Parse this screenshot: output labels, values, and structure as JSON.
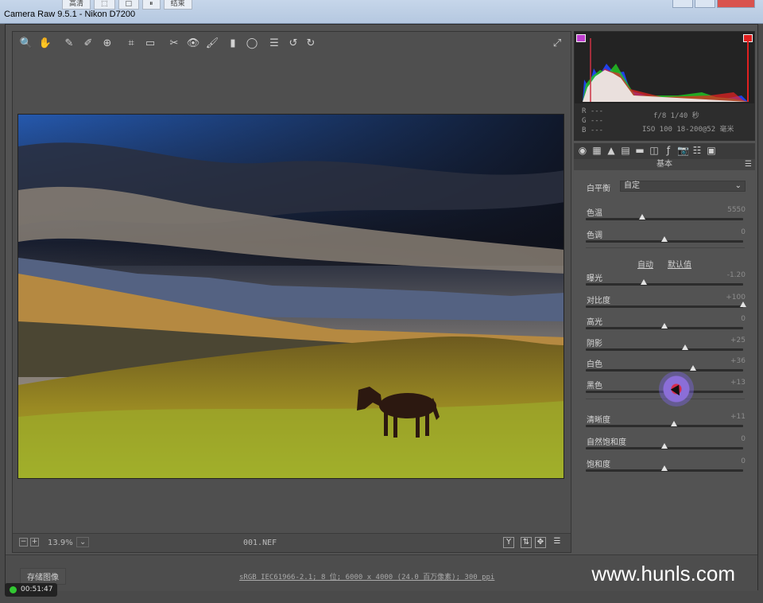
{
  "window": {
    "title": "Camera Raw 9.5.1  -  Nikon D7200",
    "ext_buttons": [
      "高清",
      "",
      "",
      "",
      "结束"
    ]
  },
  "toolbar": {
    "tools": [
      "zoom-icon",
      "hand-icon",
      "white-balance-icon",
      "color-sampler-icon",
      "target-adjust-icon",
      "crop-icon",
      "straighten-icon",
      "spot-removal-icon",
      "red-eye-icon",
      "adjustment-brush-icon",
      "graduated-filter-icon",
      "radial-filter-icon",
      "preferences-icon",
      "rotate-ccw-icon",
      "rotate-cw-icon"
    ],
    "fullscreen_icon": "fullscreen-icon"
  },
  "preview": {
    "zoom": "13.9%",
    "filename": "001.NEF",
    "compare_label": "Y"
  },
  "info": {
    "r": "R   ---",
    "g": "G   ---",
    "b": "B   ---",
    "exposure": "f/8   1/40 秒",
    "iso": "ISO 100   18-200@52 毫米"
  },
  "panel": {
    "title": "基本",
    "white_balance_label": "白平衡",
    "white_balance_value": "自定",
    "auto_label": "自动",
    "default_label": "默认值",
    "sliders": [
      {
        "label": "色温",
        "value": "5550",
        "pos": 0.36
      },
      {
        "label": "色调",
        "value": "0",
        "pos": 0.5
      },
      {
        "label": "曝光",
        "value": "-1.20",
        "pos": 0.37
      },
      {
        "label": "对比度",
        "value": "+100",
        "pos": 1.0
      },
      {
        "label": "高光",
        "value": "0",
        "pos": 0.5
      },
      {
        "label": "阴影",
        "value": "+25",
        "pos": 0.63
      },
      {
        "label": "白色",
        "value": "+36",
        "pos": 0.68
      },
      {
        "label": "黑色",
        "value": "+13",
        "pos": 0.57
      },
      {
        "label": "清晰度",
        "value": "+11",
        "pos": 0.56
      },
      {
        "label": "自然饱和度",
        "value": "0",
        "pos": 0.5
      },
      {
        "label": "饱和度",
        "value": "0",
        "pos": 0.5
      }
    ]
  },
  "status": {
    "save_label": "存储图像",
    "workflow": "sRGB IEC61966-2.1; 8 位; 6000 x 4000 (24.0 百万像素); 300 ppi",
    "watermark": "www.hunls.com"
  },
  "timer": "00:51:47"
}
